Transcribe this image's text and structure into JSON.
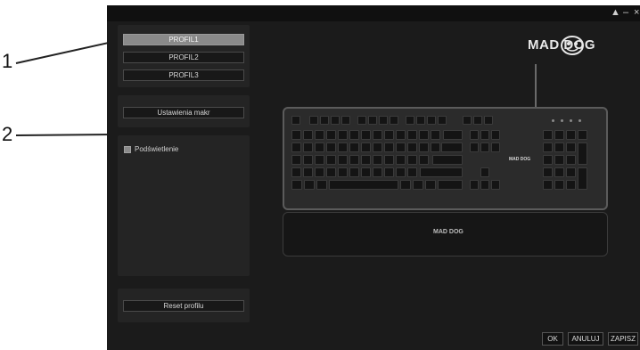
{
  "callouts": [
    "1",
    "2"
  ],
  "window": {
    "controls": [
      "▲",
      "–",
      "×"
    ]
  },
  "profiles": {
    "items": [
      "PROFIL1",
      "PROFIL2",
      "PROFIL3"
    ],
    "active_index": 0
  },
  "macro_settings_label": "Ustawienia makr",
  "backlight": {
    "label": "Podświetlenie",
    "checked": true
  },
  "reset_label": "Reset profilu",
  "brand": {
    "logo": "MAD DOG",
    "keyboard_badge": "MAD DOG",
    "rest_logo": "MAD DOG"
  },
  "footer": {
    "ok_label": "OK",
    "cancel_label": "ANULUJ",
    "save_label": "ZAPISZ"
  }
}
